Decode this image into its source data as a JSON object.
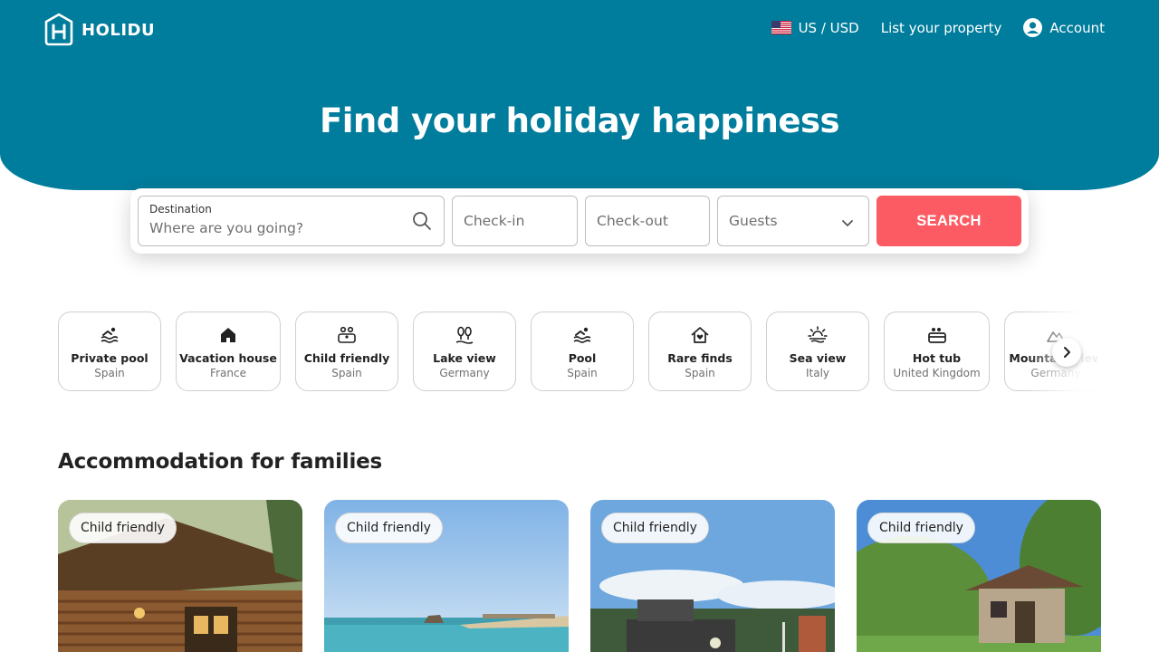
{
  "brand": {
    "name": "HOLIDU",
    "color": "#007c9c",
    "accent": "#fd5b63"
  },
  "topnav": {
    "currency": "US / USD",
    "currency_flag_icon": "us-flag-icon",
    "list_property": "List your property",
    "account": "Account",
    "account_icon": "account-circle-icon"
  },
  "hero": {
    "title": "Find your holiday happiness"
  },
  "search": {
    "destination_label": "Destination",
    "destination_placeholder": "Where are you going?",
    "checkin_placeholder": "Check-in",
    "checkout_placeholder": "Check-out",
    "guests_placeholder": "Guests",
    "button_label": "SEARCH"
  },
  "categories": [
    {
      "title": "Private pool",
      "subtitle": "Spain",
      "icon": "pool-icon"
    },
    {
      "title": "Vacation house",
      "subtitle": "France",
      "icon": "house-icon"
    },
    {
      "title": "Child friendly",
      "subtitle": "Spain",
      "icon": "family-icon"
    },
    {
      "title": "Lake view",
      "subtitle": "Germany",
      "icon": "lake-icon"
    },
    {
      "title": "Pool",
      "subtitle": "Spain",
      "icon": "pool-icon"
    },
    {
      "title": "Rare finds",
      "subtitle": "Spain",
      "icon": "heart-house-icon"
    },
    {
      "title": "Sea view",
      "subtitle": "Italy",
      "icon": "sunset-icon"
    },
    {
      "title": "Hot tub",
      "subtitle": "United Kingdom",
      "icon": "hot-tub-icon"
    },
    {
      "title": "Mountain view",
      "subtitle": "Germany",
      "icon": "mountain-icon"
    }
  ],
  "section": {
    "title": "Accommodation for families"
  },
  "cards": [
    {
      "badge": "Child friendly",
      "image": "log-cabin-photo"
    },
    {
      "badge": "Child friendly",
      "image": "beach-photo"
    },
    {
      "badge": "Child friendly",
      "image": "houseboat-photo"
    },
    {
      "badge": "Child friendly",
      "image": "stone-cottage-photo"
    }
  ]
}
